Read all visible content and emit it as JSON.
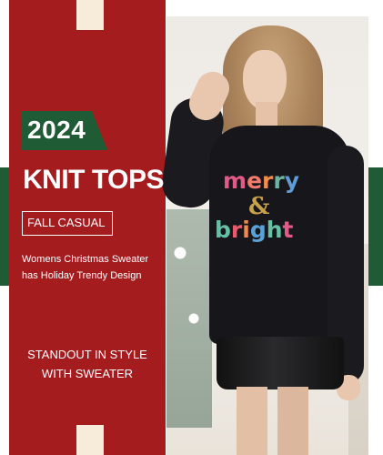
{
  "banner": {
    "year": "2024",
    "title": "KNIT TOPS",
    "tag": "FALL CASUAL",
    "description": "Womens Christmas Sweater has Holiday Trendy Design",
    "tagline": "STANDOUT IN STYLE WITH SWEATER"
  },
  "sweater_print": {
    "line1": "merry",
    "line2": "&",
    "line3": "bright",
    "line1_colors": [
      "#e05b86",
      "#f07b6e",
      "#f38b4b",
      "#6fb3a3",
      "#5f9bd6"
    ],
    "line3_colors": [
      "#68c0a4",
      "#e85a6c",
      "#f08a4b",
      "#5aa1d6",
      "#68c0a4",
      "#e05b86"
    ]
  },
  "colors": {
    "panel_red": "#a51c1f",
    "accent_green": "#1f5b34",
    "cream": "#f7ecd9",
    "sweater_black": "#17161a"
  },
  "icons": {
    "badge_shape": "angled-tab"
  }
}
